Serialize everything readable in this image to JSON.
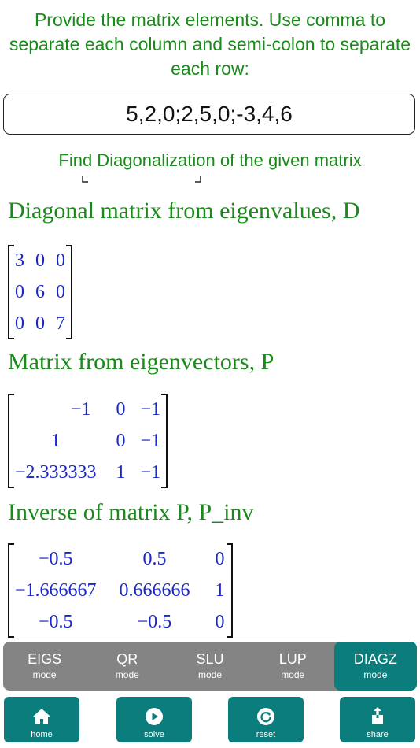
{
  "instruction": "Provide the matrix elements. Use comma to separate each column and semi-colon to separate each row:",
  "matrix_input": "5,2,0;2,5,0;-3,4,6",
  "find_link": "Find Diagonalization of the given matrix",
  "sections": {
    "d": {
      "title": "Diagonal matrix from eigenvalues, D",
      "rows": [
        [
          "3",
          "0",
          "0"
        ],
        [
          "0",
          "6",
          "0"
        ],
        [
          "0",
          "0",
          "7"
        ]
      ]
    },
    "p": {
      "title": "Matrix from eigenvectors, P",
      "rows": [
        [
          "−1",
          "0",
          "−1"
        ],
        [
          "1",
          "0",
          "−1"
        ],
        [
          "−2.333333",
          "1",
          "−1"
        ]
      ]
    },
    "pinv": {
      "title": "Inverse of matrix P, P_inv",
      "rows": [
        [
          "−0.5",
          "0.5",
          "0"
        ],
        [
          "−1.666667",
          "0.666666",
          "1"
        ],
        [
          "−0.5",
          "−0.5",
          "0"
        ]
      ]
    }
  },
  "modes": [
    {
      "label": "EIGS",
      "sub": "mode"
    },
    {
      "label": "QR",
      "sub": "mode"
    },
    {
      "label": "SLU",
      "sub": "mode"
    },
    {
      "label": "LUP",
      "sub": "mode"
    },
    {
      "label": "DIAGZ",
      "sub": "mode"
    }
  ],
  "active_mode": "DIAGZ",
  "actions": [
    {
      "label": "home",
      "icon": "home-icon"
    },
    {
      "label": "solve",
      "icon": "play-icon"
    },
    {
      "label": "reset",
      "icon": "reset-icon"
    },
    {
      "label": "share",
      "icon": "share-icon"
    }
  ],
  "colors": {
    "accent": "#0b7d7d",
    "title_green": "#1a8a1a",
    "matrix_blue": "#1a28c8",
    "modebar_gray": "#848484"
  }
}
